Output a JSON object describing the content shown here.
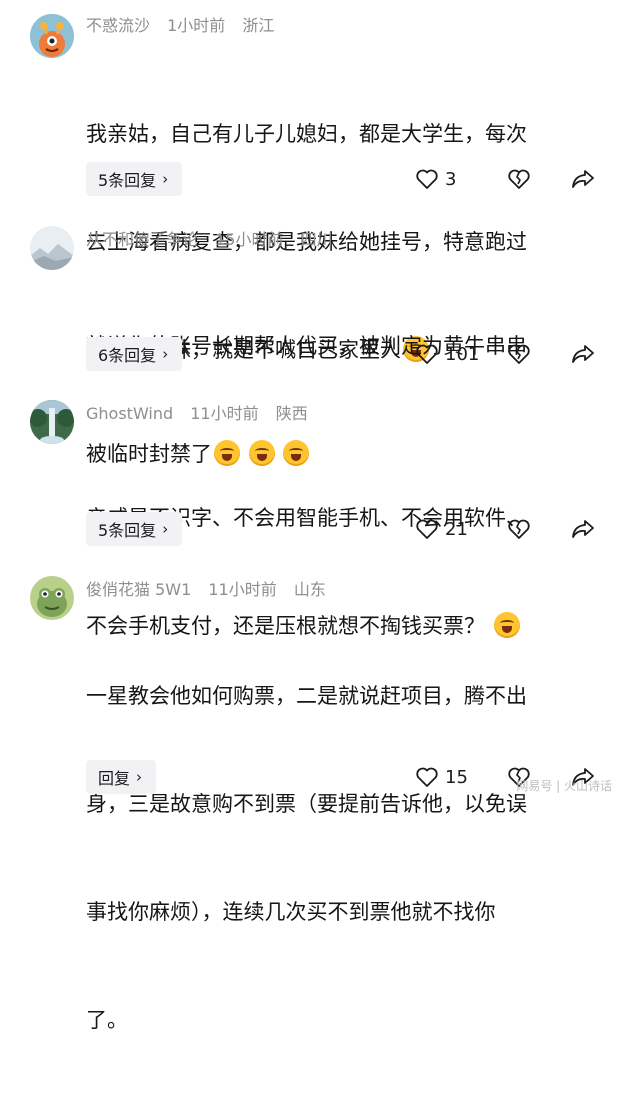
{
  "comments": [
    {
      "username": "不惑流沙",
      "time": "1小时前",
      "location": "浙江",
      "lines": [
        "我亲姑，自己有儿子儿媳妇，都是大学生，每次",
        "去上海看病复查，都是我妹给她挂号，特意跑过",
        "来叫我妹妹，就是不喊自己家里人"
      ],
      "emoji_after": 1,
      "replies_label": "5条回复",
      "likes": "3"
    },
    {
      "username": "从不和傻子争论",
      "time": "15小时前",
      "location": "四川",
      "lines": [
        "就说你的账号长期帮人代买，被判定为黄牛串串",
        "被临时封禁了"
      ],
      "emoji_after": 3,
      "replies_label": "6条回复",
      "likes": "101"
    },
    {
      "username": "GhostWind",
      "time": "11小时前",
      "location": "陕西",
      "lines": [
        "亲戚是不识字、不会用智能手机、不会用软件、",
        "不会手机支付，还是压根就想不掏钱买票？"
      ],
      "emoji_after": 1,
      "replies_label": "5条回复",
      "likes": "21"
    },
    {
      "username": "俊俏花猫 5W1",
      "time": "11小时前",
      "location": "山东",
      "lines": [
        "一星教会他如何购票，二是就说赶项目，腾不出",
        "身，三是故意购不到票（要提前告诉他，以免误",
        "事找你麻烦），连续几次买不到票他就不找你",
        "了。"
      ],
      "emoji_after": 0,
      "replies_label": "回复",
      "likes": "15"
    }
  ],
  "watermark": "网易号 | 火山诗话",
  "colors": {
    "meta": "#8e8e93",
    "reply_bg": "#f2f2f4",
    "emoji": "#ffc531"
  }
}
